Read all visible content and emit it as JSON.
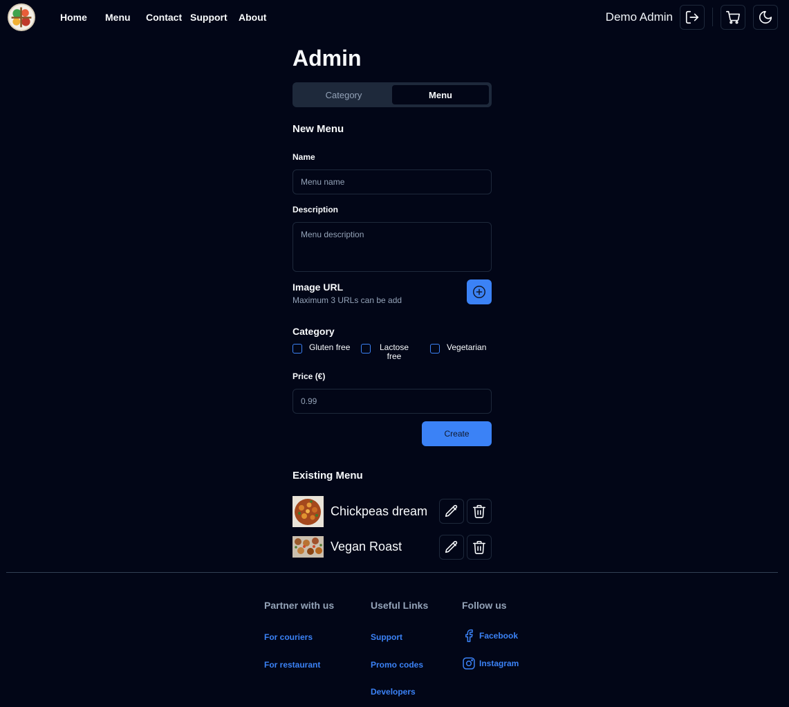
{
  "header": {
    "nav": [
      "Home",
      "Menu",
      "Contact",
      "Support",
      "About"
    ],
    "user_name": "Demo Admin",
    "icons": [
      "logout-icon",
      "cart-icon",
      "moon-icon"
    ]
  },
  "page": {
    "title": "Admin",
    "tabs": [
      {
        "label": "Category",
        "active": false
      },
      {
        "label": "Menu",
        "active": true
      }
    ]
  },
  "form": {
    "title": "New Menu",
    "name_label": "Name",
    "name_placeholder": "Menu name",
    "description_label": "Description",
    "description_placeholder": "Menu description",
    "image_label": "Image URL",
    "image_hint": "Maximum 3 URLs can be add",
    "category_label": "Category",
    "categories": [
      {
        "label": "Gluten free",
        "checked": false
      },
      {
        "label": "Lactose free",
        "checked": false
      },
      {
        "label": "Vegetarian",
        "checked": false
      }
    ],
    "price_label": "Price (€)",
    "price_placeholder": "0.99",
    "create_label": "Create"
  },
  "existing": {
    "title": "Existing Menu",
    "items": [
      {
        "name": "Chickpeas dream"
      },
      {
        "name": "Vegan Roast"
      }
    ]
  },
  "footer": {
    "columns": [
      {
        "heading": "Partner with us",
        "links": [
          "For couriers",
          "For restaurant"
        ]
      },
      {
        "heading": "Useful Links",
        "links": [
          "Support",
          "Promo codes",
          "Developers"
        ]
      },
      {
        "heading": "Follow us",
        "links": [
          "Facebook",
          "Instagram"
        ]
      }
    ]
  },
  "colors": {
    "background": "#020617",
    "accent": "#3b82f6",
    "border": "#1e293b",
    "muted_text": "#94a3b8"
  }
}
